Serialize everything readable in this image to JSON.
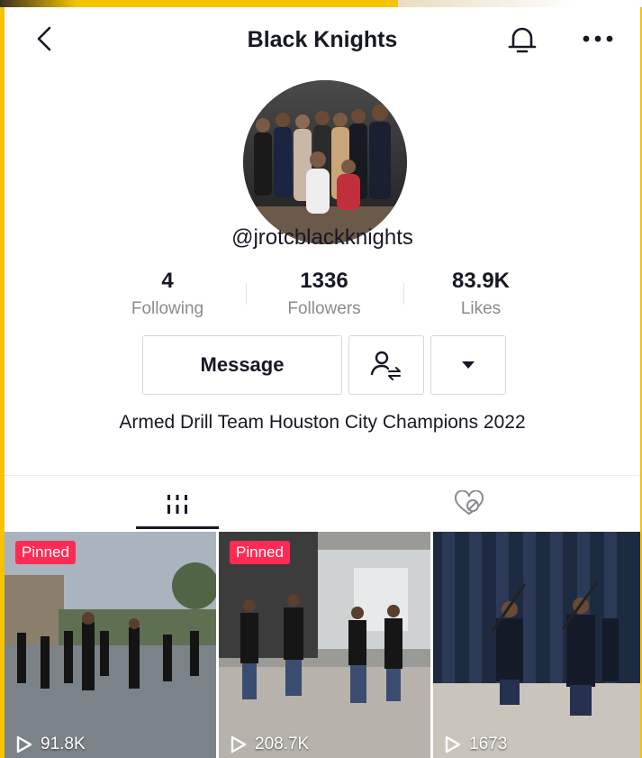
{
  "header": {
    "title": "Black Knights",
    "icons": [
      "back-chevron-icon",
      "bell-icon",
      "more-dots-icon"
    ]
  },
  "profile": {
    "username": "@jrotcblackknights",
    "stats": [
      {
        "value": "4",
        "label": "Following"
      },
      {
        "value": "1336",
        "label": "Followers"
      },
      {
        "value": "83.9K",
        "label": "Likes"
      }
    ],
    "message_label": "Message",
    "bio": "Armed Drill Team Houston City Champions 2022"
  },
  "tabs": [
    {
      "name": "videos",
      "icon": "grid-icon",
      "active": true
    },
    {
      "name": "liked",
      "icon": "hidden-heart-icon",
      "active": false
    }
  ],
  "videos": [
    {
      "pinned": "Pinned",
      "views": "91.8K"
    },
    {
      "pinned": "Pinned",
      "views": "208.7K"
    },
    {
      "pinned": "",
      "views": "1673"
    }
  ],
  "colors": {
    "pinned_badge": "#fe2c55",
    "frame_border": "#f5c400",
    "text_primary": "#161823",
    "text_secondary": "#8a8b91"
  }
}
